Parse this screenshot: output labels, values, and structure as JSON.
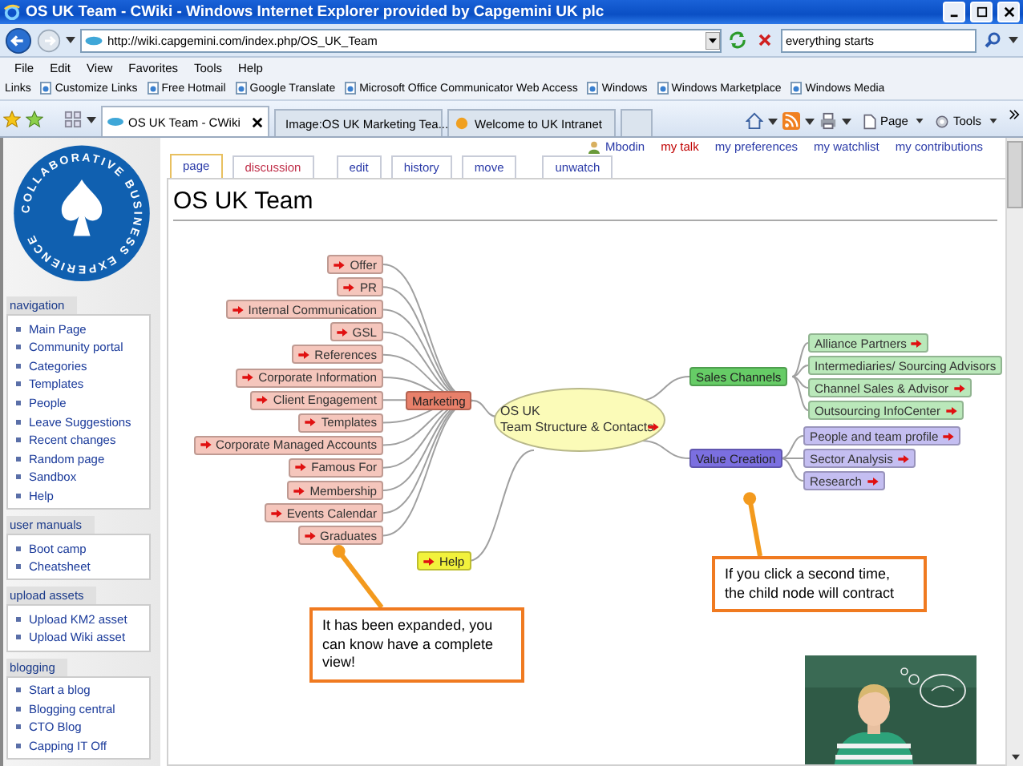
{
  "window": {
    "title": "OS UK Team - CWiki - Windows Internet Explorer provided by Capgemini UK plc"
  },
  "address_bar": {
    "url": "http://wiki.capgemini.com/index.php/OS_UK_Team"
  },
  "search": {
    "value": "everything starts"
  },
  "menu": [
    "File",
    "Edit",
    "View",
    "Favorites",
    "Tools",
    "Help"
  ],
  "links_bar": {
    "label": "Links",
    "items": [
      "Customize Links",
      "Free Hotmail",
      "Google Translate",
      "Microsoft Office Communicator Web Access",
      "Windows",
      "Windows Marketplace",
      "Windows Media"
    ]
  },
  "browser_tabs": [
    {
      "label": "OS UK Team - CWiki",
      "selected": true
    },
    {
      "label": "Image:OS UK Marketing Tea...",
      "selected": false
    },
    {
      "label": "Welcome to UK Intranet",
      "selected": false
    }
  ],
  "command_bar": [
    "Page",
    "Tools"
  ],
  "sidebar": {
    "logo_text": "COLLABORATIVE BUSINESS EXPERIENCE",
    "portlets": [
      {
        "title": "navigation",
        "items": [
          "Main Page",
          "Community portal",
          "Categories",
          "Templates",
          "People",
          "Leave Suggestions",
          "Recent changes",
          "Random page",
          "Sandbox",
          "Help"
        ]
      },
      {
        "title": "user manuals",
        "items": [
          "Boot camp",
          "Cheatsheet"
        ]
      },
      {
        "title": "upload assets",
        "items": [
          "Upload KM2 asset",
          "Upload Wiki asset"
        ]
      },
      {
        "title": "blogging",
        "items": [
          "Start a blog",
          "Blogging central",
          "CTO Blog",
          "Capping IT Off"
        ]
      }
    ]
  },
  "personal_links": [
    {
      "label": "Mbodin",
      "highlighted": false
    },
    {
      "label": "my talk",
      "highlighted": true
    },
    {
      "label": "my preferences",
      "highlighted": false
    },
    {
      "label": "my watchlist",
      "highlighted": false
    },
    {
      "label": "my contributions",
      "highlighted": false
    }
  ],
  "page_tabs": [
    {
      "label": "page",
      "selected": true,
      "new": false
    },
    {
      "label": "discussion",
      "selected": false,
      "new": true
    },
    {
      "label": "edit",
      "selected": false,
      "new": false
    },
    {
      "label": "history",
      "selected": false,
      "new": false
    },
    {
      "label": "move",
      "selected": false,
      "new": false
    },
    {
      "label": "unwatch",
      "selected": false,
      "new": false
    }
  ],
  "heading": "OS UK Team",
  "mindmap": {
    "root": {
      "lines": [
        "OS UK",
        "Team Structure & Contacts"
      ]
    },
    "branches": [
      {
        "label": "Marketing",
        "color": "#e8806a",
        "expanded": true,
        "children": [
          {
            "label": "Offer",
            "expanded": false
          },
          {
            "label": "PR",
            "expanded": false
          },
          {
            "label": "Internal Communication",
            "expanded": false
          },
          {
            "label": "GSL",
            "expanded": false
          },
          {
            "label": "References",
            "expanded": false
          },
          {
            "label": "Corporate Information",
            "expanded": false
          },
          {
            "label": "Client Engagement",
            "expanded": false
          },
          {
            "label": "Templates",
            "expanded": false
          },
          {
            "label": "Corporate Managed Accounts",
            "expanded": false
          },
          {
            "label": "Famous For",
            "expanded": false
          },
          {
            "label": "Membership",
            "expanded": false
          },
          {
            "label": "Events Calendar",
            "expanded": false
          },
          {
            "label": "Graduates",
            "expanded": false
          }
        ]
      },
      {
        "label": "Sales Channels",
        "color": "#66cc66",
        "expanded": true,
        "children": [
          {
            "label": "Alliance Partners",
            "expanded": false
          },
          {
            "label": "Intermediaries/ Sourcing Advisors"
          },
          {
            "label": "Channel Sales & Advisor",
            "expanded": false
          },
          {
            "label": "Outsourcing InfoCenter",
            "expanded": false
          }
        ]
      },
      {
        "label": "Value Creation",
        "color": "#7b6fe0",
        "expanded": true,
        "children": [
          {
            "label": "People and team profile",
            "expanded": false
          },
          {
            "label": "Sector Analysis",
            "expanded": false
          },
          {
            "label": "Research",
            "expanded": false
          }
        ]
      },
      {
        "label": "Help",
        "color": "#f2f23c",
        "expanded": false
      }
    ]
  },
  "callouts": [
    {
      "text": "It has been expanded, you can know have a complete view!"
    },
    {
      "text": "If you click a second time, the child node will contract"
    }
  ],
  "photo": {
    "kind": "picture"
  }
}
